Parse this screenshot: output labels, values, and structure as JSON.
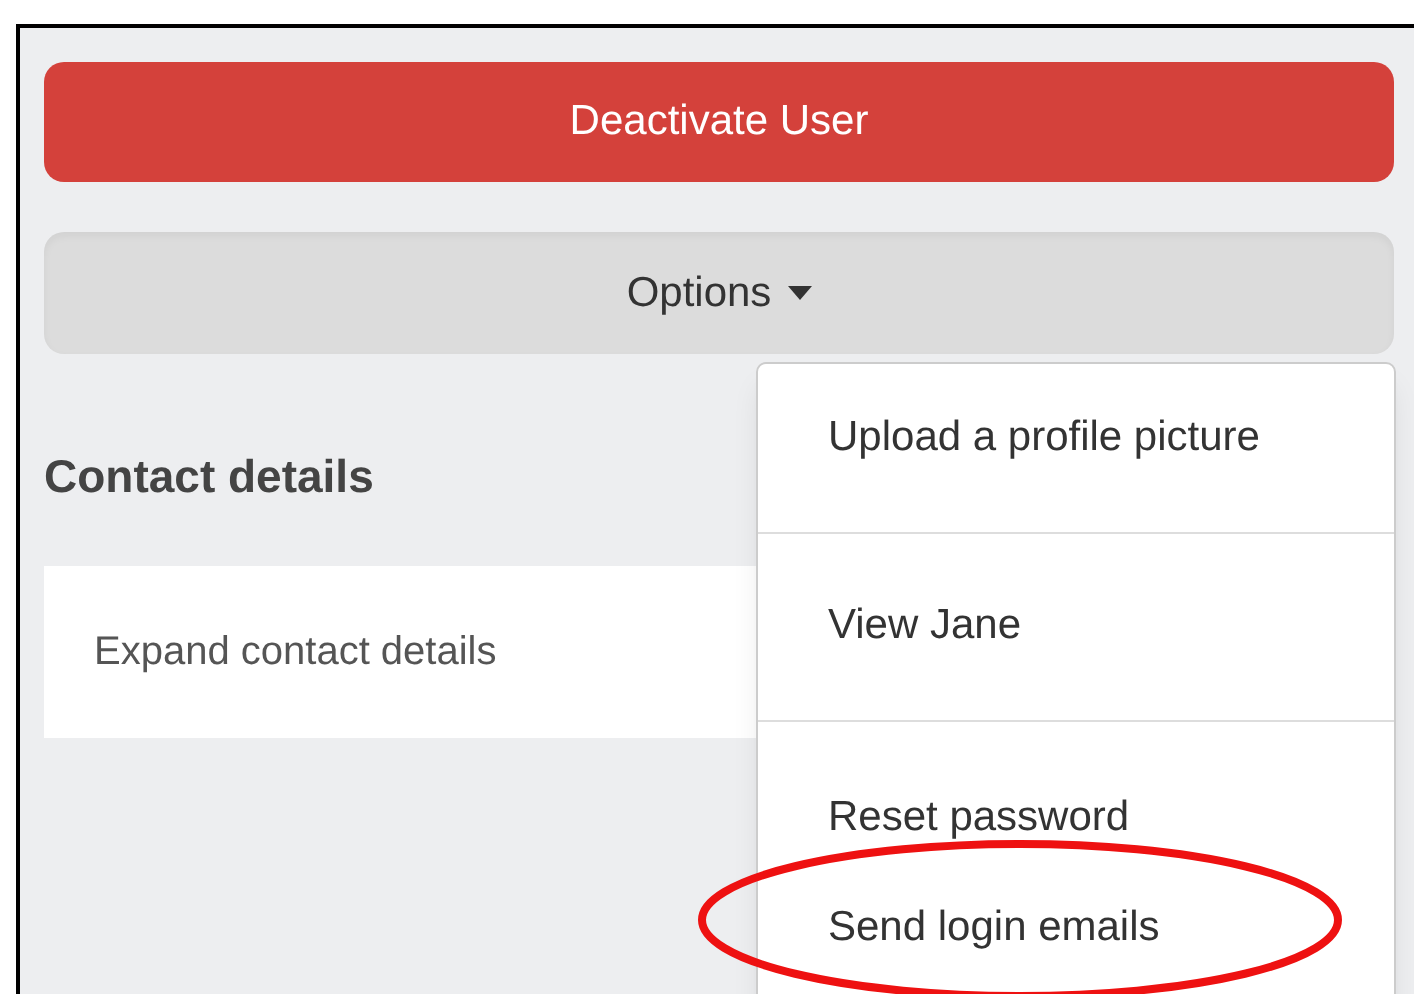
{
  "deactivate_button": {
    "label": "Deactivate User"
  },
  "options_button": {
    "label": "Options",
    "expanded": true
  },
  "contact_section": {
    "heading": "Contact details",
    "expand_link": "Expand contact details"
  },
  "options_menu": {
    "groups": [
      {
        "items": [
          "Upload a profile picture"
        ]
      },
      {
        "items": [
          "View Jane"
        ]
      },
      {
        "items": [
          "Reset password",
          "Send login emails"
        ]
      }
    ]
  },
  "annotation": {
    "kind": "ellipse",
    "color": "#ee1111"
  }
}
